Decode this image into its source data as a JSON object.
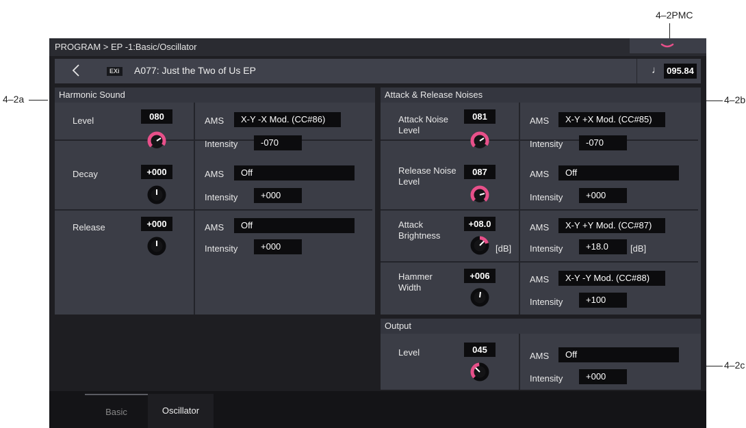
{
  "callouts": {
    "pmc": "4–2PMC",
    "a": "4–2a",
    "b": "4–2b",
    "c": "4–2c"
  },
  "header": {
    "breadcrumb": "PROGRAM > EP -1:Basic/Oscillator",
    "program_badge": "EXi",
    "program_name": "A077: Just the Two of Us EP",
    "tempo": "095.84"
  },
  "harmonic": {
    "title": "Harmonic Sound",
    "params": [
      {
        "label": "Level",
        "value": "080",
        "ams_label": "AMS",
        "ams": "X-Y -X Mod. (CC#86)",
        "int_label": "Intensity",
        "intensity": "-070"
      },
      {
        "label": "Decay",
        "value": "+000",
        "ams_label": "AMS",
        "ams": "Off",
        "int_label": "Intensity",
        "intensity": "+000"
      },
      {
        "label": "Release",
        "value": "+000",
        "ams_label": "AMS",
        "ams": "Off",
        "int_label": "Intensity",
        "intensity": "+000"
      }
    ]
  },
  "noises": {
    "title": "Attack & Release Noises",
    "params": [
      {
        "label": "Attack Noise Level",
        "value": "081",
        "ams_label": "AMS",
        "ams": "X-Y +X Mod. (CC#85)",
        "int_label": "Intensity",
        "intensity": "-070"
      },
      {
        "label": "Release Noise Level",
        "value": "087",
        "ams_label": "AMS",
        "ams": "Off",
        "int_label": "Intensity",
        "intensity": "+000"
      },
      {
        "label": "Attack Brightness",
        "value": "+08.0",
        "unit": "[dB]",
        "ams_label": "AMS",
        "ams": "X-Y +Y Mod. (CC#87)",
        "int_label": "Intensity",
        "intensity": "+18.0",
        "int_unit": "[dB]"
      },
      {
        "label": "Hammer Width",
        "value": "+006",
        "ams_label": "AMS",
        "ams": "X-Y -Y Mod. (CC#88)",
        "int_label": "Intensity",
        "intensity": "+100"
      }
    ]
  },
  "output": {
    "title": "Output",
    "label": "Level",
    "value": "045",
    "ams_label": "AMS",
    "ams": "Off",
    "int_label": "Intensity",
    "intensity": "+000"
  },
  "tabs": [
    {
      "label": "Basic",
      "active": false
    },
    {
      "label": "Oscillator",
      "active": true
    }
  ],
  "colors": {
    "knob_accent": "#e8508a",
    "panel": "#3b3d46",
    "value_box": "#0c0c0e"
  },
  "icons": [
    "chevron-down-icon",
    "back-arrow-icon",
    "quarter-note-icon",
    "knob-icon"
  ]
}
